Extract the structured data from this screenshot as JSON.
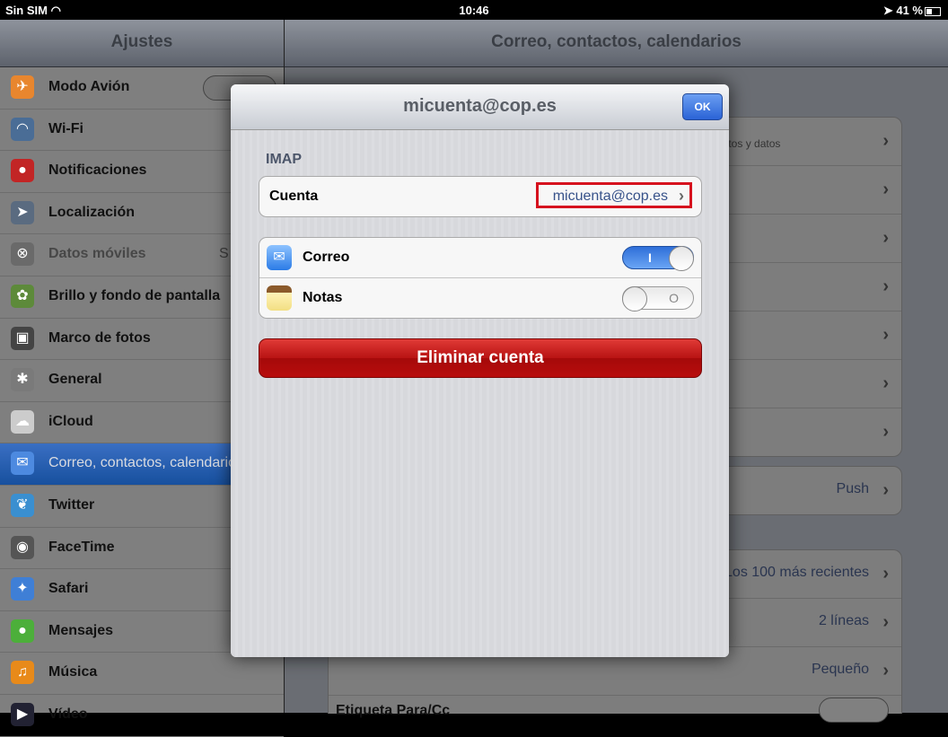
{
  "status_bar": {
    "carrier": "Sin SIM",
    "time": "10:46",
    "battery": "41 %",
    "wifi_icon": "wifi-icon",
    "location_icon": "location-arrow-icon"
  },
  "sidebar": {
    "title": "Ajustes",
    "items": [
      {
        "label": "Modo Avión",
        "icon": "airplane-icon",
        "color": "#e8862e"
      },
      {
        "label": "Wi-Fi",
        "icon": "wifi-icon",
        "color": "#4a6d96"
      },
      {
        "label": "Notificaciones",
        "icon": "notifications-icon",
        "color": "#c22525"
      },
      {
        "label": "Localización",
        "icon": "location-icon",
        "color": "#5a6b80"
      },
      {
        "label": "Datos móviles",
        "extra": "S",
        "icon": "cellular-icon",
        "color": "#6a6a6a"
      },
      {
        "label": "Brillo y fondo de pantalla",
        "icon": "brightness-icon",
        "color": "#5d8a3a"
      },
      {
        "label": "Marco de fotos",
        "icon": "picture-frame-icon",
        "color": "#444"
      },
      {
        "label": "General",
        "icon": "gear-icon",
        "color": "#7a7a7a"
      },
      {
        "label": "iCloud",
        "icon": "cloud-icon",
        "color": "#ccc"
      },
      {
        "label": "Correo, contactos, calendarios",
        "icon": "mail-icon",
        "color": "#4d8ae0"
      },
      {
        "label": "Twitter",
        "icon": "twitter-icon",
        "color": "#3a8fd0"
      },
      {
        "label": "FaceTime",
        "icon": "facetime-icon",
        "color": "#555"
      },
      {
        "label": "Safari",
        "icon": "safari-icon",
        "color": "#3f7fd6"
      },
      {
        "label": "Mensajes",
        "icon": "messages-icon",
        "color": "#4caf3a"
      },
      {
        "label": "Música",
        "icon": "music-icon",
        "color": "#e88a1a"
      },
      {
        "label": "Vídeo",
        "icon": "video-icon",
        "color": "#223"
      }
    ]
  },
  "main": {
    "title": "Correo, contactos, calendarios",
    "group1_sub": "entos y datos",
    "push": "Push",
    "show": "Los 100 más recientes",
    "preview": "2 líneas",
    "font_size": "Pequeño",
    "to_cc_label": "Etiqueta Para/Cc"
  },
  "modal": {
    "title": "micuenta@cop.es",
    "ok_label": "OK",
    "section": "IMAP",
    "account_label": "Cuenta",
    "account_value": "micuenta@cop.es",
    "mail_label": "Correo",
    "mail_on": true,
    "notes_label": "Notas",
    "notes_on": false,
    "toggle_on_mark": "I",
    "toggle_off_mark": "O",
    "delete_label": "Eliminar cuenta",
    "highlight_color": "#d6121e"
  }
}
